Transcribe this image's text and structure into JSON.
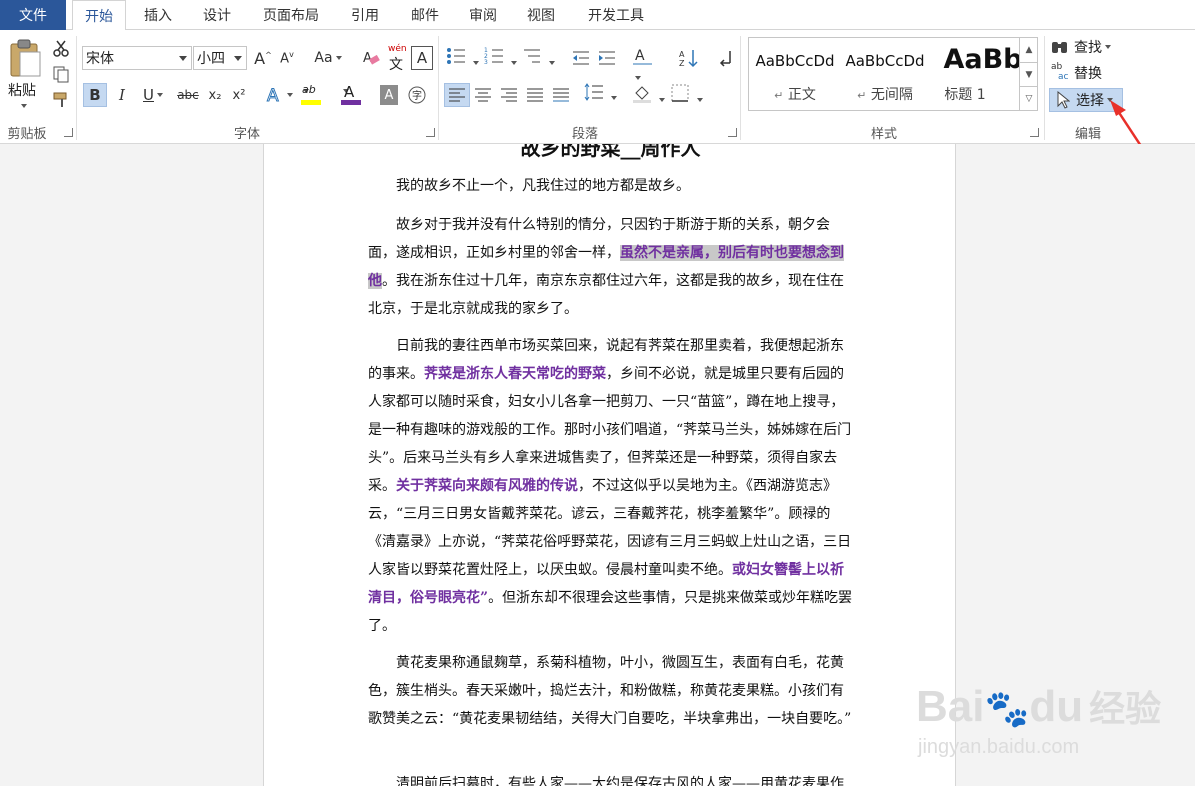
{
  "tabs": {
    "file": "文件",
    "home": "开始",
    "insert": "插入",
    "design": "设计",
    "layout": "页面布局",
    "references": "引用",
    "mailings": "邮件",
    "review": "审阅",
    "view": "视图",
    "developer": "开发工具"
  },
  "clipboard": {
    "paste": "粘贴",
    "label": "剪贴板"
  },
  "font": {
    "name": "宋体",
    "size": "小四",
    "change_case": "Aa",
    "phonetic": "wén",
    "phonetic2": "文",
    "bold": "B",
    "italic": "I",
    "underline": "U",
    "strike": "abc",
    "subscript": "x₂",
    "superscript": "x²",
    "highlight_letters": "ab",
    "label": "字体",
    "highlight_color": "#ffff00",
    "font_color": "#7030a0"
  },
  "paragraph": {
    "label": "段落"
  },
  "styles": {
    "items": [
      {
        "sample": "AaBbCcDd",
        "name": "正文",
        "prefix": "↵"
      },
      {
        "sample": "AaBbCcDd",
        "name": "无间隔",
        "prefix": "↵"
      },
      {
        "sample": "AaBb",
        "name": "标题 1",
        "prefix": ""
      }
    ],
    "label": "样式"
  },
  "editing": {
    "find": "查找",
    "replace": "替换",
    "select": "选择",
    "label": "编辑",
    "replace_icon_top": "ab",
    "replace_icon_bottom": "ac"
  },
  "document": {
    "title_partial": "故乡的野菜__周作人",
    "paragraphs": [
      {
        "segments": [
          {
            "t": "我的故乡不止一个，凡我住过的地方都是故乡。",
            "s": "n"
          }
        ]
      },
      {
        "segments": [
          {
            "t": "故乡对于我并没有什么特别的情分，只因钓于斯游于斯的关系，朝夕会面，遂成相识，正如乡村里的邻舍一样，",
            "s": "n"
          },
          {
            "t": "虽然不是亲属，别后有时也要想念到他",
            "s": "sel"
          },
          {
            "t": "。我在浙东住过十几年，南京东京都住过六年，这都是我的故乡，现在住在北京，于是北京就成我的家乡了。",
            "s": "n"
          }
        ]
      },
      {
        "segments": [
          {
            "t": "日前我的妻往西单市场买菜回来，说起有荠菜在那里卖着，我便想起浙东的事来。",
            "s": "n"
          },
          {
            "t": "荠菜是浙东人春天常吃的野菜",
            "s": "hl"
          },
          {
            "t": "，乡间不必说，就是城里只要有后园的人家都可以随时采食，妇女小儿各拿一把剪刀、一只“苗篮”，蹲在地上搜寻，是一种有趣味的游戏般的工作。那时小孩们唱道，“荠菜马兰头，姊姊嫁在后门头”。后来马兰头有乡人拿来进城售卖了，但荠菜还是一种野菜，须得自家去采。",
            "s": "n"
          },
          {
            "t": "关于荠菜向来颇有风雅的传说",
            "s": "hl"
          },
          {
            "t": "，不过这似乎以吴地为主。《西湖游览志》云，“三月三日男女皆戴荠菜花。谚云，三春戴荠花，桃李羞繁华”。顾禄的《清嘉录》上亦说，“荠菜花俗呼野菜花，因谚有三月三蚂蚁上灶山之语，三日人家皆以野菜花置灶陉上，以厌虫蚁。侵晨村童叫卖不绝。",
            "s": "n"
          },
          {
            "t": "或妇女簪髻上以祈清目，俗号眼亮花”",
            "s": "hl"
          },
          {
            "t": "。但浙东却不很理会这些事情，只是挑来做菜或炒年糕吃罢了。",
            "s": "n"
          }
        ]
      },
      {
        "segments": [
          {
            "t": "黄花麦果称通鼠麹草，系菊科植物，叶小，微圆互生，表面有白毛，花黄色，簇生梢头。春天采嫩叶，捣烂去汁，和粉做糕，称黄花麦果糕。小孩们有歌赞美之云：“黄花麦果韧结结，关得大门自要吃，半块拿弗出，一块自要吃。”",
            "s": "n"
          }
        ]
      },
      {
        "segments": [
          {
            "t": "清明前后扫墓时，有些人家——大约是保存古风的人家——用黄花麦果作",
            "s": "n"
          }
        ]
      }
    ]
  },
  "watermark": {
    "brand": "Bai",
    "brand2": "du",
    "cn": "经验",
    "url": "jingyan.baidu.com"
  }
}
